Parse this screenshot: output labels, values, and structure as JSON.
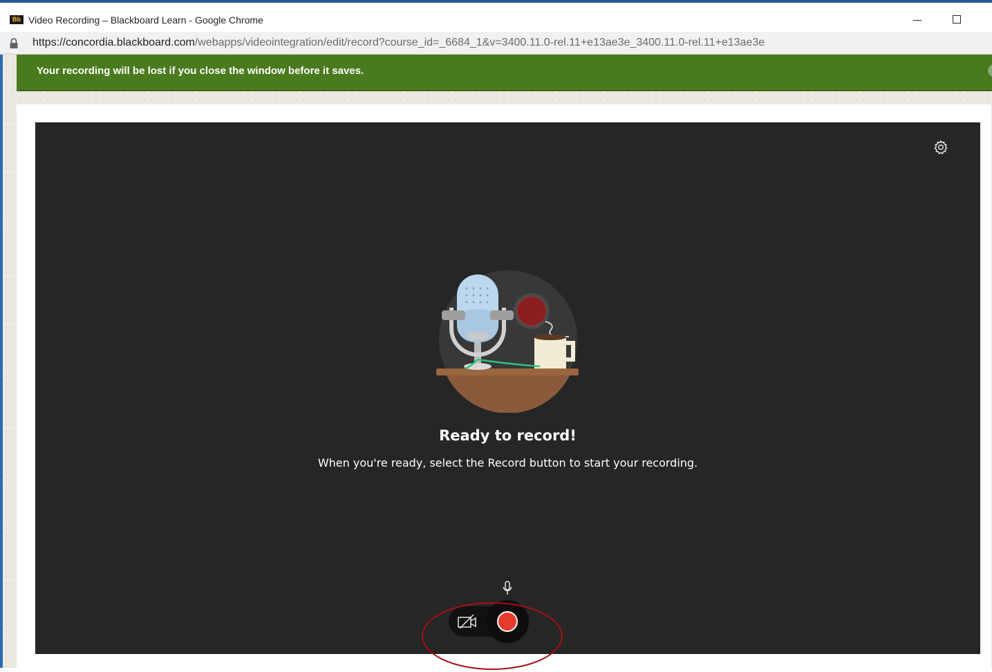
{
  "window": {
    "favicon_text": "Bb",
    "title": "Video Recording – Blackboard Learn - Google Chrome"
  },
  "address": {
    "host": "https://concordia.blackboard.com",
    "path": "/webapps/videointegration/edit/record?course_id=_6684_1&v=3400.11.0-rel.11+e13ae3e_3400.11.0-rel.11+e13ae3e"
  },
  "notice": {
    "text": "Your recording will be lost if you close the window before it saves."
  },
  "recorder": {
    "heading": "Ready to record!",
    "instructions": "When you're ready, select the Record button to start your recording."
  },
  "icons": {
    "lock": "lock-icon",
    "settings": "gear-icon",
    "microphone": "microphone-icon",
    "camera_off": "camera-off-icon",
    "record": "record-icon"
  },
  "colors": {
    "notice_bg": "#4a7a1e",
    "stage_bg": "#262626",
    "record_red": "#e53b2c",
    "annotation_red": "#a3101a"
  }
}
